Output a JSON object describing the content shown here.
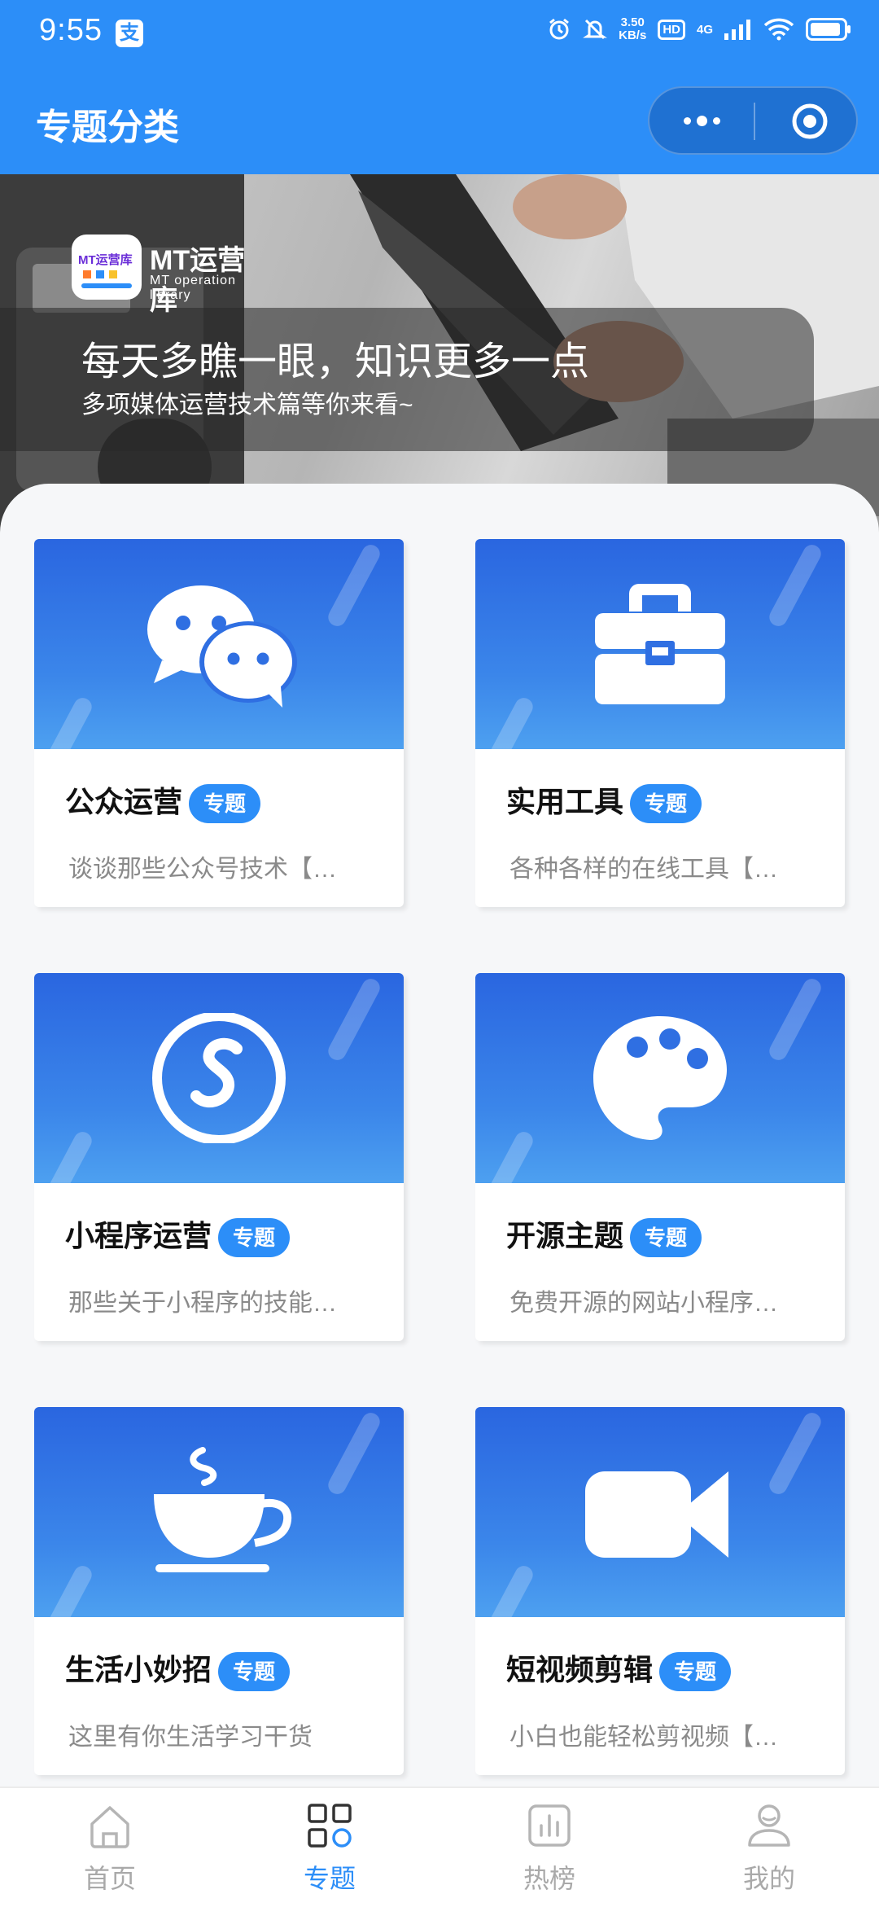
{
  "status_bar": {
    "time": "9:55",
    "app_badge": "支",
    "net_speed": "3.50",
    "net_speed_unit": "KB/s",
    "hd": "HD",
    "network": "4G"
  },
  "header": {
    "title": "专题分类"
  },
  "banner": {
    "logo_text": "MT运营库",
    "logo_sub": "MT operation library",
    "title": "每天多瞧一眼，知识更多一点",
    "subtitle": "多项媒体运营技术篇等你来看~"
  },
  "cards": [
    {
      "title": "公众运营",
      "badge": "专题",
      "desc": "谈谈那些公众号技术【…",
      "icon": "wechat-icon"
    },
    {
      "title": "实用工具",
      "badge": "专题",
      "desc": "各种各样的在线工具【…",
      "icon": "toolbox-icon"
    },
    {
      "title": "小程序运营",
      "badge": "专题",
      "desc": "那些关于小程序的技能…",
      "icon": "mini-program-icon"
    },
    {
      "title": "开源主题",
      "badge": "专题",
      "desc": "免费开源的网站小程序…",
      "icon": "palette-icon"
    },
    {
      "title": "生活小妙招",
      "badge": "专题",
      "desc": "这里有你生活学习干货",
      "icon": "coffee-cup-icon"
    },
    {
      "title": "短视频剪辑",
      "badge": "专题",
      "desc": "小白也能轻松剪视频【…",
      "icon": "video-camera-icon"
    }
  ],
  "tabbar": {
    "items": [
      {
        "label": "首页",
        "icon": "home-icon",
        "active": false
      },
      {
        "label": "专题",
        "icon": "grid-icon",
        "active": true
      },
      {
        "label": "热榜",
        "icon": "chart-icon",
        "active": false
      },
      {
        "label": "我的",
        "icon": "user-icon",
        "active": false
      }
    ]
  },
  "colors": {
    "primary": "#2c8ef8",
    "card_gradient_top": "#2a66e0",
    "card_gradient_bottom": "#4da0f0",
    "desc_text": "#8a8a8a",
    "tab_inactive": "#a9a9a9"
  }
}
